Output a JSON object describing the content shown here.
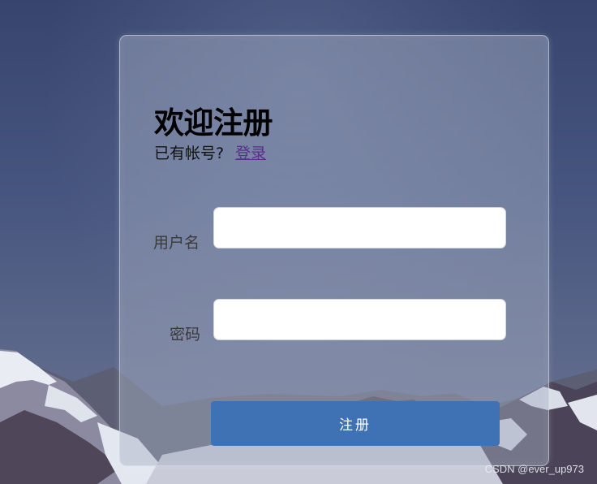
{
  "page": {
    "title": "欢迎注册",
    "login_prompt": "已有帐号?",
    "login_link": "登录"
  },
  "form": {
    "username_label": "用户名",
    "username_value": "",
    "password_label": "密码",
    "password_value": "",
    "submit_label": "注册"
  },
  "watermark": "CSDN @ever_up973",
  "colors": {
    "button": "#3f72b5",
    "link": "#5a2d8a"
  }
}
